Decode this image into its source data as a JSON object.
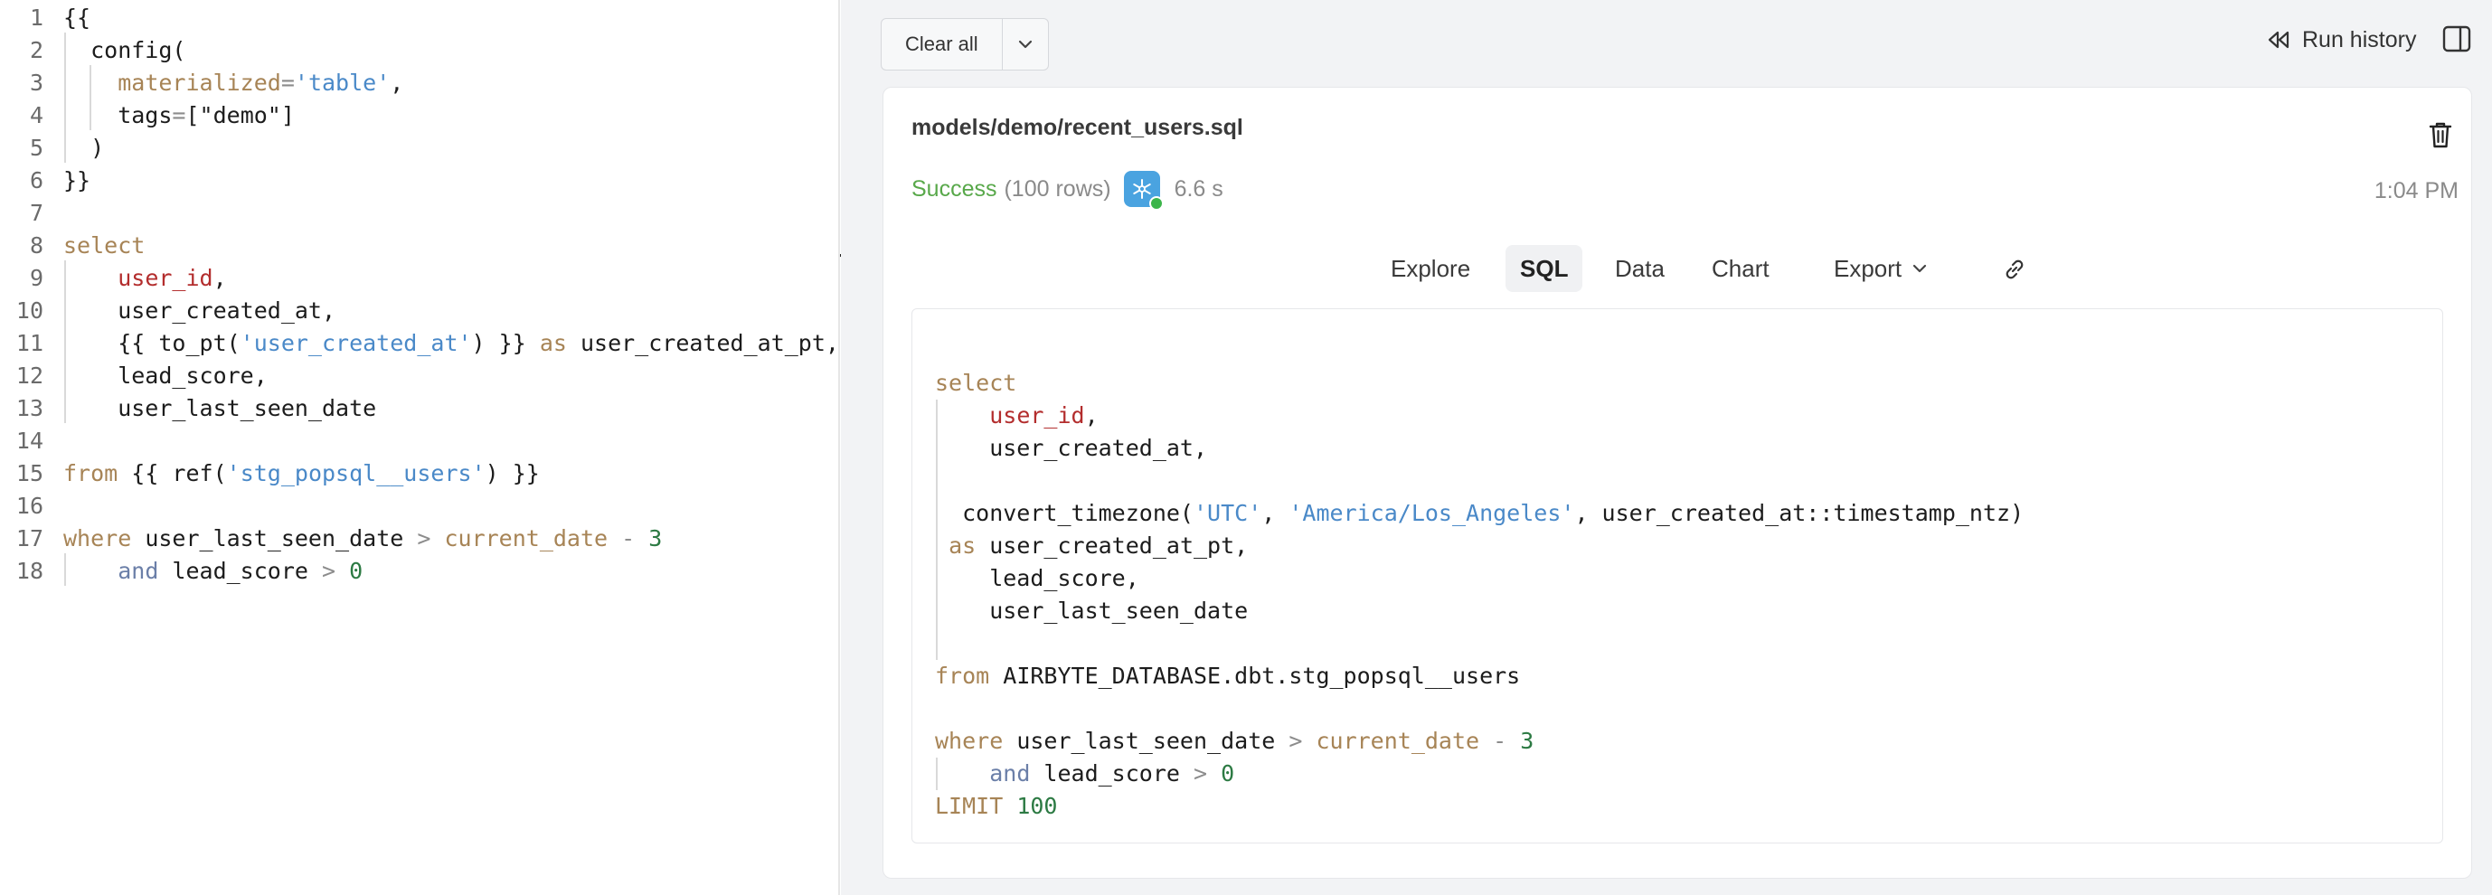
{
  "editor": {
    "lines": [
      {
        "n": "1",
        "parts": [
          {
            "t": "{{",
            "c": ""
          }
        ]
      },
      {
        "n": "2",
        "parts": [
          {
            "t": "  config(",
            "c": ""
          }
        ]
      },
      {
        "n": "3",
        "parts": [
          {
            "t": "    ",
            "c": ""
          },
          {
            "t": "materialized",
            "c": "param"
          },
          {
            "t": "=",
            "c": "op"
          },
          {
            "t": "'table'",
            "c": "str"
          },
          {
            "t": ",",
            "c": ""
          }
        ]
      },
      {
        "n": "4",
        "parts": [
          {
            "t": "    tags",
            "c": ""
          },
          {
            "t": "=",
            "c": "op"
          },
          {
            "t": "[\"demo\"]",
            "c": ""
          }
        ]
      },
      {
        "n": "5",
        "parts": [
          {
            "t": "  )",
            "c": ""
          }
        ]
      },
      {
        "n": "6",
        "parts": [
          {
            "t": "}}",
            "c": ""
          }
        ]
      },
      {
        "n": "7",
        "parts": []
      },
      {
        "n": "8",
        "parts": [
          {
            "t": "select",
            "c": "kw-from"
          }
        ]
      },
      {
        "n": "9",
        "parts": [
          {
            "t": "    ",
            "c": ""
          },
          {
            "t": "user_id",
            "c": "col-red"
          },
          {
            "t": ",",
            "c": ""
          }
        ]
      },
      {
        "n": "10",
        "parts": [
          {
            "t": "    user_created_at,",
            "c": ""
          }
        ]
      },
      {
        "n": "11",
        "parts": [
          {
            "t": "    {{ to_pt(",
            "c": ""
          },
          {
            "t": "'user_created_at'",
            "c": "str"
          },
          {
            "t": ") }} ",
            "c": ""
          },
          {
            "t": "as",
            "c": "kw-from"
          },
          {
            "t": " user_created_at_pt,",
            "c": ""
          }
        ]
      },
      {
        "n": "12",
        "parts": [
          {
            "t": "    lead_score,",
            "c": ""
          }
        ]
      },
      {
        "n": "13",
        "parts": [
          {
            "t": "    user_last_seen_date",
            "c": ""
          }
        ]
      },
      {
        "n": "14",
        "parts": []
      },
      {
        "n": "15",
        "parts": [
          {
            "t": "from",
            "c": "kw-from"
          },
          {
            "t": " {{ ref(",
            "c": ""
          },
          {
            "t": "'stg_popsql__users'",
            "c": "str"
          },
          {
            "t": ") }}",
            "c": ""
          }
        ]
      },
      {
        "n": "16",
        "parts": []
      },
      {
        "n": "17",
        "parts": [
          {
            "t": "where",
            "c": "kw-from"
          },
          {
            "t": " user_last_seen_date ",
            "c": ""
          },
          {
            "t": ">",
            "c": "op"
          },
          {
            "t": " ",
            "c": ""
          },
          {
            "t": "current_date",
            "c": "kw-from"
          },
          {
            "t": " ",
            "c": ""
          },
          {
            "t": "-",
            "c": "op"
          },
          {
            "t": " ",
            "c": ""
          },
          {
            "t": "3",
            "c": "num"
          }
        ]
      },
      {
        "n": "18",
        "parts": [
          {
            "t": "    ",
            "c": ""
          },
          {
            "t": "and",
            "c": "kw-and"
          },
          {
            "t": " lead_score ",
            "c": ""
          },
          {
            "t": ">",
            "c": "op"
          },
          {
            "t": " ",
            "c": ""
          },
          {
            "t": "0",
            "c": "num"
          }
        ]
      }
    ]
  },
  "toolbar": {
    "clear_all_label": "Clear all",
    "run_history_label": "Run history"
  },
  "result": {
    "title": "models/demo/recent_users.sql",
    "status": "Success",
    "rows": "(100 rows)",
    "duration": "6.6 s",
    "timestamp": "1:04 PM"
  },
  "tabs": {
    "explore": "Explore",
    "sql": "SQL",
    "data": "Data",
    "chart": "Chart",
    "export": "Export"
  },
  "sql": {
    "lines": [
      {
        "parts": [
          {
            "t": "select",
            "c": "kw-from"
          }
        ]
      },
      {
        "parts": [
          {
            "t": "    ",
            "c": ""
          },
          {
            "t": "user_id",
            "c": "col-red"
          },
          {
            "t": ",",
            "c": ""
          }
        ]
      },
      {
        "parts": [
          {
            "t": "    user_created_at,",
            "c": ""
          }
        ]
      },
      {
        "parts": []
      },
      {
        "parts": [
          {
            "t": "  convert_timezone(",
            "c": ""
          },
          {
            "t": "'UTC'",
            "c": "str"
          },
          {
            "t": ", ",
            "c": ""
          },
          {
            "t": "'America/Los_Angeles'",
            "c": "str"
          },
          {
            "t": ", user_created_at::timestamp_ntz)",
            "c": ""
          }
        ]
      },
      {
        "parts": [
          {
            "t": " ",
            "c": ""
          },
          {
            "t": "as",
            "c": "kw-from"
          },
          {
            "t": " user_created_at_pt,",
            "c": ""
          }
        ]
      },
      {
        "parts": [
          {
            "t": "    lead_score,",
            "c": ""
          }
        ]
      },
      {
        "parts": [
          {
            "t": "    user_last_seen_date",
            "c": ""
          }
        ]
      },
      {
        "parts": []
      },
      {
        "parts": [
          {
            "t": "from",
            "c": "kw-from"
          },
          {
            "t": " AIRBYTE_DATABASE.dbt.stg_popsql__users",
            "c": ""
          }
        ]
      },
      {
        "parts": []
      },
      {
        "parts": [
          {
            "t": "where",
            "c": "kw-from"
          },
          {
            "t": " user_last_seen_date ",
            "c": ""
          },
          {
            "t": ">",
            "c": "op"
          },
          {
            "t": " ",
            "c": ""
          },
          {
            "t": "current_date",
            "c": "kw-from"
          },
          {
            "t": " ",
            "c": ""
          },
          {
            "t": "-",
            "c": "op"
          },
          {
            "t": " ",
            "c": ""
          },
          {
            "t": "3",
            "c": "num"
          }
        ]
      },
      {
        "parts": [
          {
            "t": "    ",
            "c": ""
          },
          {
            "t": "and",
            "c": "kw-and"
          },
          {
            "t": " lead_score ",
            "c": ""
          },
          {
            "t": ">",
            "c": "op"
          },
          {
            "t": " ",
            "c": ""
          },
          {
            "t": "0",
            "c": "num"
          }
        ]
      },
      {
        "parts": [
          {
            "t": "LIMIT",
            "c": "kw-from"
          },
          {
            "t": " ",
            "c": ""
          },
          {
            "t": "100",
            "c": "num"
          }
        ]
      }
    ]
  },
  "icons": {
    "run_history": "rewind-icon",
    "panel": "sidebar-panel-icon",
    "trash": "trash-icon",
    "snowflake": "snowflake-icon",
    "link": "link-icon",
    "chevron": "chevron-down-icon"
  }
}
